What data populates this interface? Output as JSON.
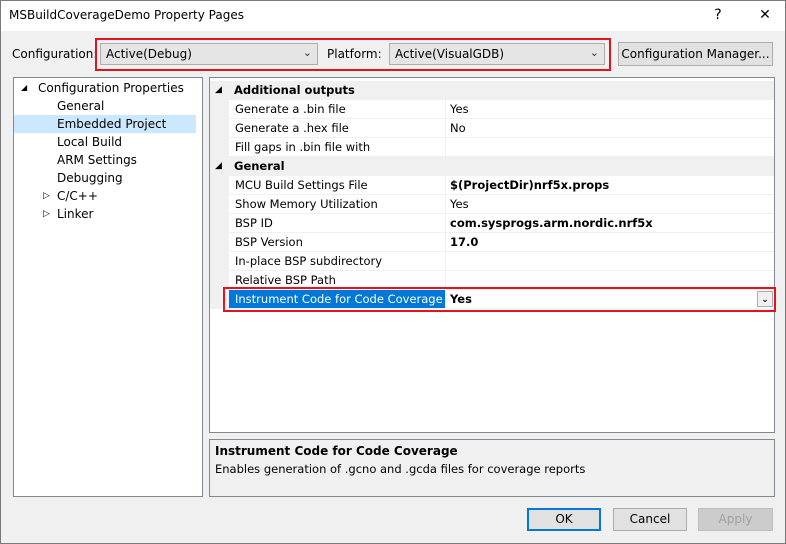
{
  "window": {
    "title": "MSBuildCoverageDemo Property Pages",
    "help_glyph": "?",
    "close_glyph": "✕"
  },
  "config_bar": {
    "configuration_label": "Configuration:",
    "configuration_value": "Active(Debug)",
    "platform_label": "Platform:",
    "platform_value": "Active(VisualGDB)",
    "configuration_manager_label": "Configuration Manager..."
  },
  "tree": {
    "items": [
      {
        "label": "Configuration Properties",
        "expander": "◢"
      },
      {
        "label": "General"
      },
      {
        "label": "Embedded Project"
      },
      {
        "label": "Local Build"
      },
      {
        "label": "ARM Settings"
      },
      {
        "label": "Debugging"
      },
      {
        "label": "C/C++",
        "expander": "▷"
      },
      {
        "label": "Linker",
        "expander": "▷"
      }
    ]
  },
  "grid": {
    "categories": {
      "additional_outputs": {
        "label": "Additional outputs",
        "expander": "◢"
      },
      "general": {
        "label": "General",
        "expander": "◢"
      }
    },
    "rows": [
      {
        "name": "Generate a .bin file",
        "value": "Yes"
      },
      {
        "name": "Generate a .hex file",
        "value": "No"
      },
      {
        "name": "Fill gaps in .bin file with",
        "value": ""
      },
      {
        "name": "MCU Build Settings File",
        "value": "$(ProjectDir)nrf5x.props"
      },
      {
        "name": "Show Memory Utilization",
        "value": "Yes"
      },
      {
        "name": "BSP ID",
        "value": "com.sysprogs.arm.nordic.nrf5x"
      },
      {
        "name": "BSP Version",
        "value": "17.0"
      },
      {
        "name": "In-place BSP subdirectory",
        "value": ""
      },
      {
        "name": "Relative BSP Path",
        "value": ""
      },
      {
        "name": "Instrument Code for Code Coverage",
        "value": "Yes"
      }
    ]
  },
  "description": {
    "title": "Instrument Code for Code Coverage",
    "text": "Enables generation of .gcno and .gcda files for coverage reports"
  },
  "buttons": {
    "ok": "OK",
    "cancel": "Cancel",
    "apply": "Apply"
  },
  "colors": {
    "highlight_red": "#e0141e",
    "selection_blue": "#0078d7",
    "tree_selected": "#cce8ff"
  }
}
